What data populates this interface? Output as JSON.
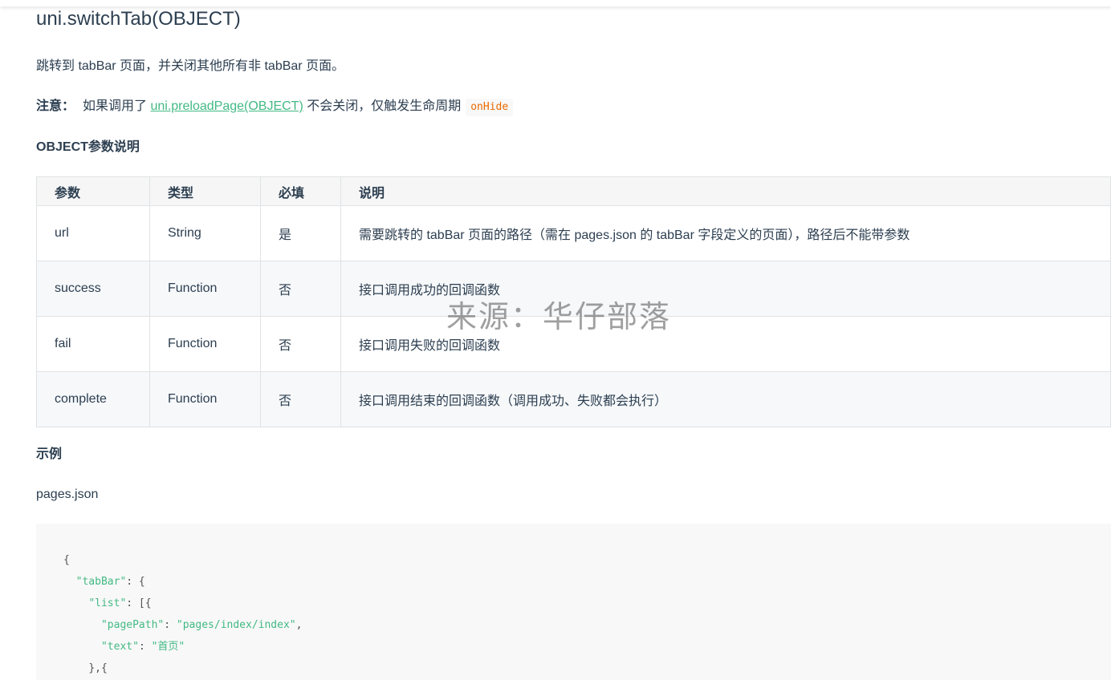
{
  "title": "uni.switchTab(OBJECT)",
  "description": "跳转到 tabBar 页面，并关闭其他所有非 tabBar 页面。",
  "note": {
    "label": "注意：",
    "before": "如果调用了 ",
    "link": "uni.preloadPage(OBJECT)",
    "after": " 不会关闭，仅触发生命周期",
    "code": "onHide"
  },
  "params_heading": "OBJECT参数说明",
  "table": {
    "headers": [
      "参数",
      "类型",
      "必填",
      "说明"
    ],
    "rows": [
      [
        "url",
        "String",
        "是",
        "需要跳转的 tabBar 页面的路径（需在 pages.json 的 tabBar 字段定义的页面），路径后不能带参数"
      ],
      [
        "success",
        "Function",
        "否",
        "接口调用成功的回调函数"
      ],
      [
        "fail",
        "Function",
        "否",
        "接口调用失败的回调函数"
      ],
      [
        "complete",
        "Function",
        "否",
        "接口调用结束的回调函数（调用成功、失败都会执行）"
      ]
    ]
  },
  "example_heading": "示例",
  "example_file": "pages.json",
  "code": {
    "l1": "{",
    "k_tabBar": "\"tabBar\"",
    "t_tabBar": ": {",
    "k_list": "\"list\"",
    "t_list": ": [{",
    "k_pagePath": "\"pagePath\"",
    "v_pagePath": "\"pages/index/index\"",
    "k_text": "\"text\"",
    "v_text": "\"首页\"",
    "l_last": "},{"
  },
  "watermark": "来源：华仔部落"
}
